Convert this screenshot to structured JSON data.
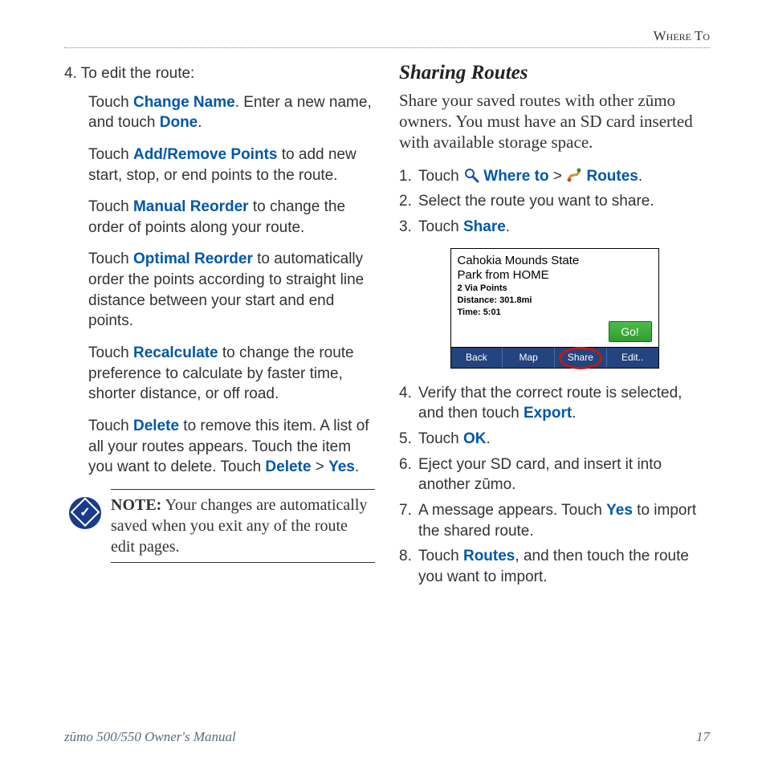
{
  "header": {
    "section": "Where To"
  },
  "left": {
    "step4_lead": "4. To edit the route:",
    "items": [
      {
        "pre": "Touch ",
        "b1": "Change Name",
        "mid": ". Enter a new name, and touch ",
        "b2": "Done",
        "post": "."
      },
      {
        "pre": "Touch ",
        "b1": "Add/Remove Points",
        "post": " to add new start, stop, or end points to the route."
      },
      {
        "pre": "Touch ",
        "b1": "Manual Reorder",
        "post": " to change the order of points along your route."
      },
      {
        "pre": "Touch ",
        "b1": "Optimal Reorder",
        "post": " to automatically order the points according to straight line distance between your start and end points."
      },
      {
        "pre": "Touch ",
        "b1": "Recalculate",
        "post": " to change the route preference to calculate by faster time, shorter distance, or off road."
      },
      {
        "pre": "Touch ",
        "b1": "Delete",
        "mid": " to remove this item. A list of all your routes appears. Touch the item you want to delete. Touch ",
        "b2": "Delete",
        "mid2": " > ",
        "b3": "Yes",
        "post": "."
      }
    ],
    "note_label": "NOTE:",
    "note_text": " Your changes are automatically saved when you exit any of the route edit pages."
  },
  "right": {
    "title": "Sharing Routes",
    "intro": "Share your saved routes with other zūmo owners. You must have an SD card inserted with available storage space.",
    "steps_a": [
      {
        "n": "1.",
        "pre": "Touch ",
        "b1": "Where to",
        "mid": " > ",
        "b2": "Routes",
        "post": "."
      },
      {
        "n": "2.",
        "pre": "Select the route you want to share."
      },
      {
        "n": "3.",
        "pre": "Touch ",
        "b1": "Share",
        "post": "."
      }
    ],
    "screenshot": {
      "title_line1": "Cahokia Mounds State",
      "title_line2": "Park from HOME",
      "meta1": "2 Via Points",
      "meta2": "Distance: 301.8mi",
      "meta3": "Time: 5:01",
      "go": "Go!",
      "buttons": [
        "Back",
        "Map",
        "Share",
        "Edit.."
      ]
    },
    "steps_b": [
      {
        "n": "4.",
        "pre": "Verify that the correct route is selected, and then touch ",
        "b1": "Export",
        "post": "."
      },
      {
        "n": "5.",
        "pre": "Touch ",
        "b1": "OK",
        "post": "."
      },
      {
        "n": "6.",
        "pre": "Eject your SD card, and insert it into another zūmo."
      },
      {
        "n": "7.",
        "pre": "A message appears. Touch ",
        "b1": "Yes",
        "post": " to import the shared route."
      },
      {
        "n": "8.",
        "pre": "Touch ",
        "b1": "Routes",
        "post": ", and then touch the route you want to import."
      }
    ]
  },
  "footer": {
    "left": "zūmo 500/550 Owner's Manual",
    "right": "17"
  }
}
